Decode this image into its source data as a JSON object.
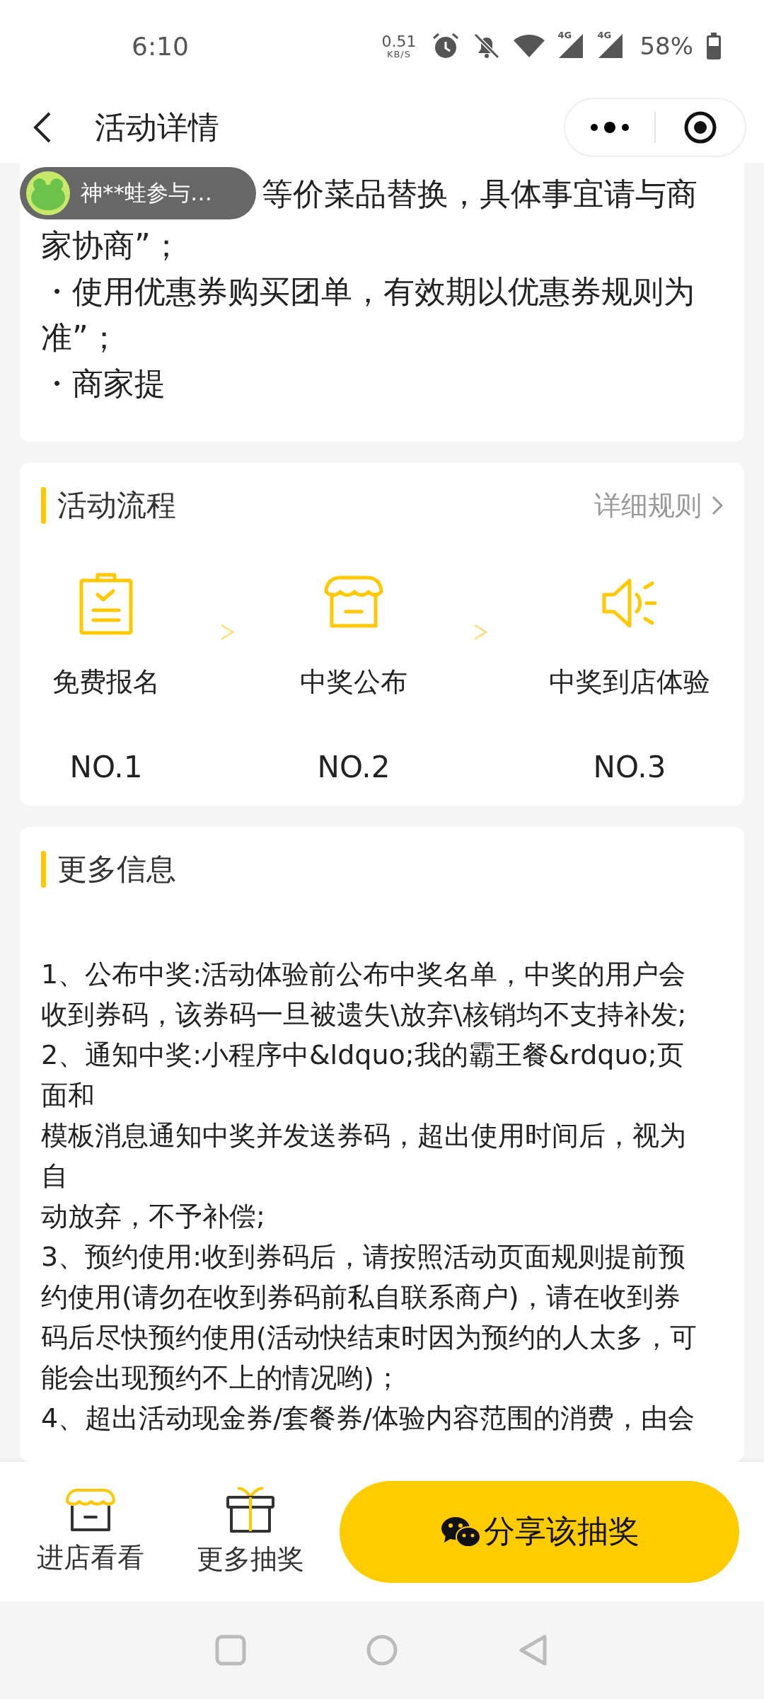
{
  "status_bar": {
    "time": "6:10",
    "speed": "0.51",
    "speed_unit": "KB/S",
    "networks": [
      "4G",
      "4G"
    ],
    "battery": "58%"
  },
  "nav": {
    "title": "活动详情"
  },
  "notice": {
    "lines": [
      "等价菜品替换，具体事宜请与商",
      "家协商”；",
      "・使用优惠券购买团单，有效期以优惠券规则为准”；",
      "・商家提"
    ]
  },
  "toast": {
    "text": "神**蛙参与…"
  },
  "flow": {
    "title": "活动流程",
    "rules_link": "详细规则",
    "steps": [
      {
        "kind": "signup",
        "label": "免费报名",
        "number": "NO.1"
      },
      {
        "kind": "store",
        "label": "中奖公布",
        "number": "NO.2"
      },
      {
        "kind": "announce",
        "label": "中奖到店体验",
        "number": "NO.3"
      }
    ]
  },
  "more_info": {
    "title": "更多信息",
    "paragraphs": [
      "1、公布中奖:活动体验前公布中奖名单，中奖的用户会收到券码，该券码一旦被遗失\\放弃\\核销均不支持补发;",
      "2、通知中奖:小程序中&ldquo;我的霸王餐&rdquo;页面和",
      "模板消息通知中奖并发送券码，超出使用时间后，视为自",
      "动放弃，不予补偿;",
      "3、预约使用:收到券码后，请按照活动页面规则提前预约使用(请勿在收到券码前私自联系商户)，请在收到券码后尽快预约使用(活动快结束时因为预约的人太多，可能会出现预约不上的情况哟)；",
      "4、超出活动现金券/套餐券/体验内容范围的消费，由会"
    ]
  },
  "bottom_bar": {
    "actions": [
      {
        "kind": "store",
        "label": "进店看看"
      },
      {
        "kind": "gift",
        "label": "更多抽奖"
      }
    ],
    "share_button": "分享该抽奖"
  }
}
